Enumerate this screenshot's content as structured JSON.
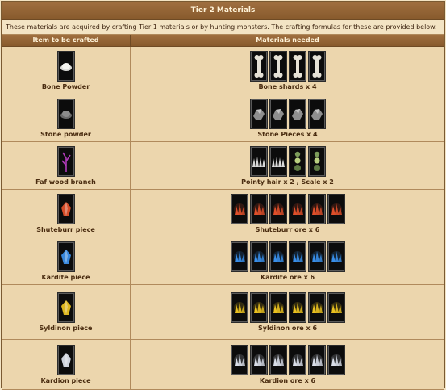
{
  "title": "Tier 2 Materials",
  "description": "These materials are acquired by crafting Tier 1 materials or by hunting monsters. The crafting formulas for these are provided below.",
  "columns": {
    "item": "Item to be crafted",
    "materials": "Materials needed"
  },
  "rows": [
    {
      "item": "Bone Powder",
      "materials": "Bone shards x 4",
      "item_icon": "bone-powder-icon",
      "material_icons": [
        "bone-icon",
        "bone-icon",
        "bone-icon",
        "bone-icon"
      ]
    },
    {
      "item": "Stone powder",
      "materials": "Stone Pieces x 4",
      "item_icon": "stone-powder-icon",
      "material_icons": [
        "stone-icon",
        "stone-icon",
        "stone-icon",
        "stone-icon"
      ]
    },
    {
      "item": "Faf wood branch",
      "materials": "Pointy hair x 2 , Scale x 2",
      "item_icon": "wood-branch-icon",
      "material_icons": [
        "pointy-hair-icon",
        "pointy-hair-icon",
        "scale-icon",
        "scale-icon"
      ]
    },
    {
      "item": "Shuteburr piece",
      "materials": "Shuteburr ore x 6",
      "item_icon": "shuteburr-piece-icon",
      "material_icons": [
        "shuteburr-ore-icon",
        "shuteburr-ore-icon",
        "shuteburr-ore-icon",
        "shuteburr-ore-icon",
        "shuteburr-ore-icon",
        "shuteburr-ore-icon"
      ]
    },
    {
      "item": "Kardite piece",
      "materials": "Kardite ore x 6",
      "item_icon": "kardite-piece-icon",
      "material_icons": [
        "kardite-ore-icon",
        "kardite-ore-icon",
        "kardite-ore-icon",
        "kardite-ore-icon",
        "kardite-ore-icon",
        "kardite-ore-icon"
      ]
    },
    {
      "item": "Syldinon piece",
      "materials": "Syldinon ore x 6",
      "item_icon": "syldinon-piece-icon",
      "material_icons": [
        "syldinon-ore-icon",
        "syldinon-ore-icon",
        "syldinon-ore-icon",
        "syldinon-ore-icon",
        "syldinon-ore-icon",
        "syldinon-ore-icon"
      ]
    },
    {
      "item": "Kardion piece",
      "materials": "Kardion ore x 6",
      "item_icon": "kardion-piece-icon",
      "material_icons": [
        "kardion-ore-icon",
        "kardion-ore-icon",
        "kardion-ore-icon",
        "kardion-ore-icon",
        "kardion-ore-icon",
        "kardion-ore-icon"
      ]
    }
  ],
  "colors": {
    "header": "#875a2c",
    "row": "#ecd6ad",
    "shuteburr": "#e0502a",
    "kardite": "#3a8ee8",
    "syldinon": "#e8c020",
    "kardion": "#d8dde8"
  }
}
